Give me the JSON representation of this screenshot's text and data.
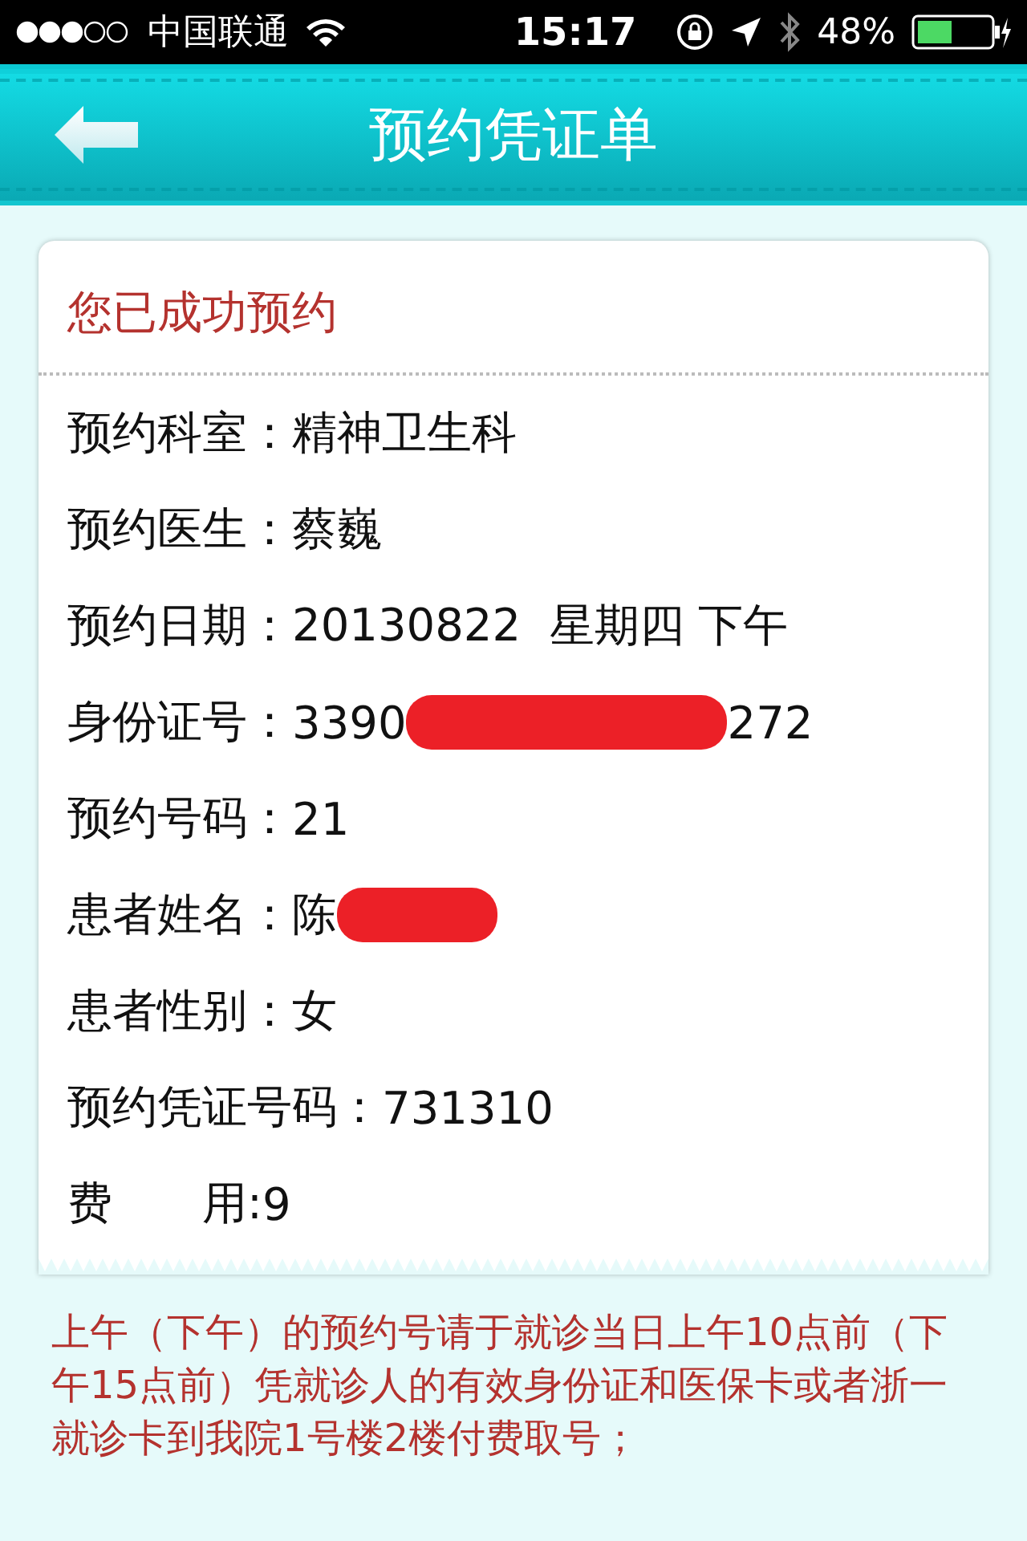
{
  "status_bar": {
    "carrier": "中国联通",
    "time": "15:17",
    "battery": "48%"
  },
  "header": {
    "title": "预约凭证单"
  },
  "card": {
    "title": "您已成功预约",
    "rows": [
      {
        "label": "预约科室：",
        "value": "精神卫生科"
      },
      {
        "label": "预约医生：",
        "value": "蔡巍"
      },
      {
        "label": "预约日期：",
        "value": "20130822  星期四 下午"
      },
      {
        "label": "身份证号：",
        "value": "3390",
        "redacted": true,
        "value_end": "272"
      },
      {
        "label": "预约号码：",
        "value": "21"
      },
      {
        "label": "患者姓名：",
        "value": "陈",
        "redacted": true
      },
      {
        "label": "患者性别：",
        "value": "女"
      },
      {
        "label": "预约凭证号码：",
        "value": "731310"
      },
      {
        "label": "费　　用:",
        "value": "9"
      }
    ]
  },
  "note": "上午（下午）的预约号请于就诊当日上午10点前（下午15点前）凭就诊人的有效身份证和医保卡或者浙一就诊卡到我院1号楼2楼付费取号；"
}
